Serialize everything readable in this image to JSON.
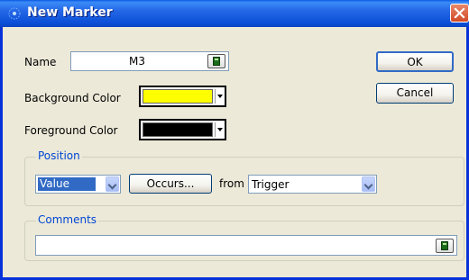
{
  "window": {
    "title": "New Marker",
    "close_label": "×"
  },
  "name_field": {
    "label": "Name",
    "value": "M3"
  },
  "background": {
    "label": "Background Color",
    "color": "#ffff00"
  },
  "foreground": {
    "label": "Foreground Color",
    "color": "#000000"
  },
  "position": {
    "group_title": "Position",
    "type_value": "Value",
    "occurs_label": "Occurs...",
    "from_label": "from",
    "from_value": "Trigger"
  },
  "comments": {
    "group_title": "Comments",
    "value": ""
  },
  "buttons": {
    "ok_label": "OK",
    "cancel_label": "Cancel"
  },
  "icons": {
    "title": "marker-dots-icon",
    "calc": "calculator-icon"
  },
  "colors": {
    "title_bar": "#0a58e4",
    "dialog_bg": "#ece9d8",
    "group_title": "#0046d5",
    "selection": "#316ac5"
  }
}
